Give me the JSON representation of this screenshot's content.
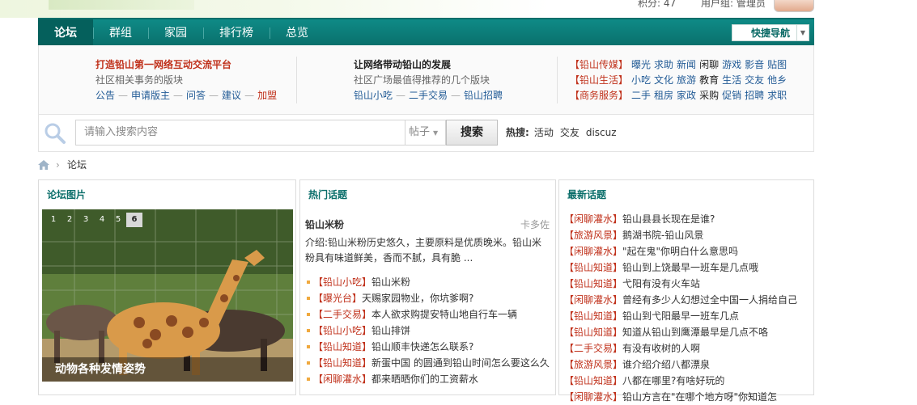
{
  "top": {
    "points": "积分: 47",
    "usergroup": "用户组: 管理员"
  },
  "nav": {
    "items": [
      "论坛",
      "群组",
      "家园",
      "排行榜",
      "总览"
    ],
    "quick_nav": "快捷导航"
  },
  "info": {
    "col1": {
      "title": "打造铅山第一网络互动交流平台",
      "sub": "社区相关事务的版块",
      "links": [
        "公告",
        "申请版主",
        "问答",
        "建议",
        "加盟"
      ]
    },
    "col2": {
      "title": "让网络带动铅山的发展",
      "sub": "社区广场最值得推荐的几个版块",
      "links": [
        "铅山小吃",
        "二手交易",
        "铅山招聘"
      ]
    },
    "col3": [
      {
        "group": "【铅山传媒】",
        "items": [
          "曝光",
          "求助",
          "新闻",
          "闲聊",
          "游戏",
          "影音",
          "贴图"
        ]
      },
      {
        "group": "【铅山生活】",
        "items": [
          "小吃",
          "文化",
          "旅游",
          "教育",
          "生活",
          "交友",
          "他乡"
        ]
      },
      {
        "group": "【商务服务】",
        "items": [
          "二手",
          "租房",
          "家政",
          "采购",
          "促销",
          "招聘",
          "求职"
        ]
      }
    ]
  },
  "search": {
    "placeholder": "请输入搜索内容",
    "type": "帖子",
    "button": "搜索",
    "hot_label": "热搜:",
    "hot_terms": [
      "活动",
      "交友",
      "discuz"
    ]
  },
  "breadcrumb": {
    "current": "论坛"
  },
  "panel_pic": {
    "title": "论坛图片",
    "slides": [
      "1",
      "2",
      "3",
      "4",
      "5",
      "6"
    ],
    "active_slide": 6,
    "caption": "动物各种发情姿势"
  },
  "panel_hot": {
    "title": "热门话题",
    "featured": {
      "title": "铅山米粉",
      "author": "卡多佐",
      "desc": "介绍:铅山米粉历史悠久，主要原料是优质晚米。铅山米粉具有味道鲜美，香而不腻，具有脆 ..."
    },
    "items": [
      {
        "tag": "【铅山小吃】",
        "text": "铅山米粉"
      },
      {
        "tag": "【曝光台】",
        "text": "天赐家园物业，你坑爹啊?"
      },
      {
        "tag": "【二手交易】",
        "text": "本人欲求购提安特山地自行车一辆"
      },
      {
        "tag": "【铅山小吃】",
        "text": "铅山排饼"
      },
      {
        "tag": "【铅山知道】",
        "text": "铅山顺丰快递怎么联系?"
      },
      {
        "tag": "【铅山知道】",
        "text": "新蛋中国 的圆通到铅山时间怎么要这么久"
      },
      {
        "tag": "【闲聊灌水】",
        "text": "都来晒晒你们的工资薪水"
      }
    ]
  },
  "panel_new": {
    "title": "最新话题",
    "items": [
      {
        "tag": "【闲聊灌水】",
        "text": "铅山县县长现在是谁?"
      },
      {
        "tag": "【旅游风景】",
        "text": "鹅湖书院-铅山风景"
      },
      {
        "tag": "【闲聊灌水】",
        "text": "\"起在鬼\"你明白什么意思吗"
      },
      {
        "tag": "【铅山知道】",
        "text": "铅山到上饶最早一班车是几点哦"
      },
      {
        "tag": "【铅山知道】",
        "text": "弋阳有没有火车站"
      },
      {
        "tag": "【闲聊灌水】",
        "text": "曾经有多少人幻想过全中国一人捐给自己"
      },
      {
        "tag": "【铅山知道】",
        "text": "铅山到弋阳最早一班车几点"
      },
      {
        "tag": "【铅山知道】",
        "text": "知道从铅山到鹰潭最早是几点不咯"
      },
      {
        "tag": "【二手交易】",
        "text": "有没有收树的人啊"
      },
      {
        "tag": "【旅游风景】",
        "text": "谁介绍介绍八都漂泉"
      },
      {
        "tag": "【铅山知道】",
        "text": "八都在哪里?有啥好玩的"
      },
      {
        "tag": "【闲聊灌水】",
        "text": "铅山方言在\"在哪个地方呀\"你知道怎"
      }
    ]
  },
  "colors": {
    "nav_bg": "#0b7d79",
    "tag_red": "#c0311b",
    "link_blue": "#225b96",
    "panel_title": "#0a6e6a"
  }
}
